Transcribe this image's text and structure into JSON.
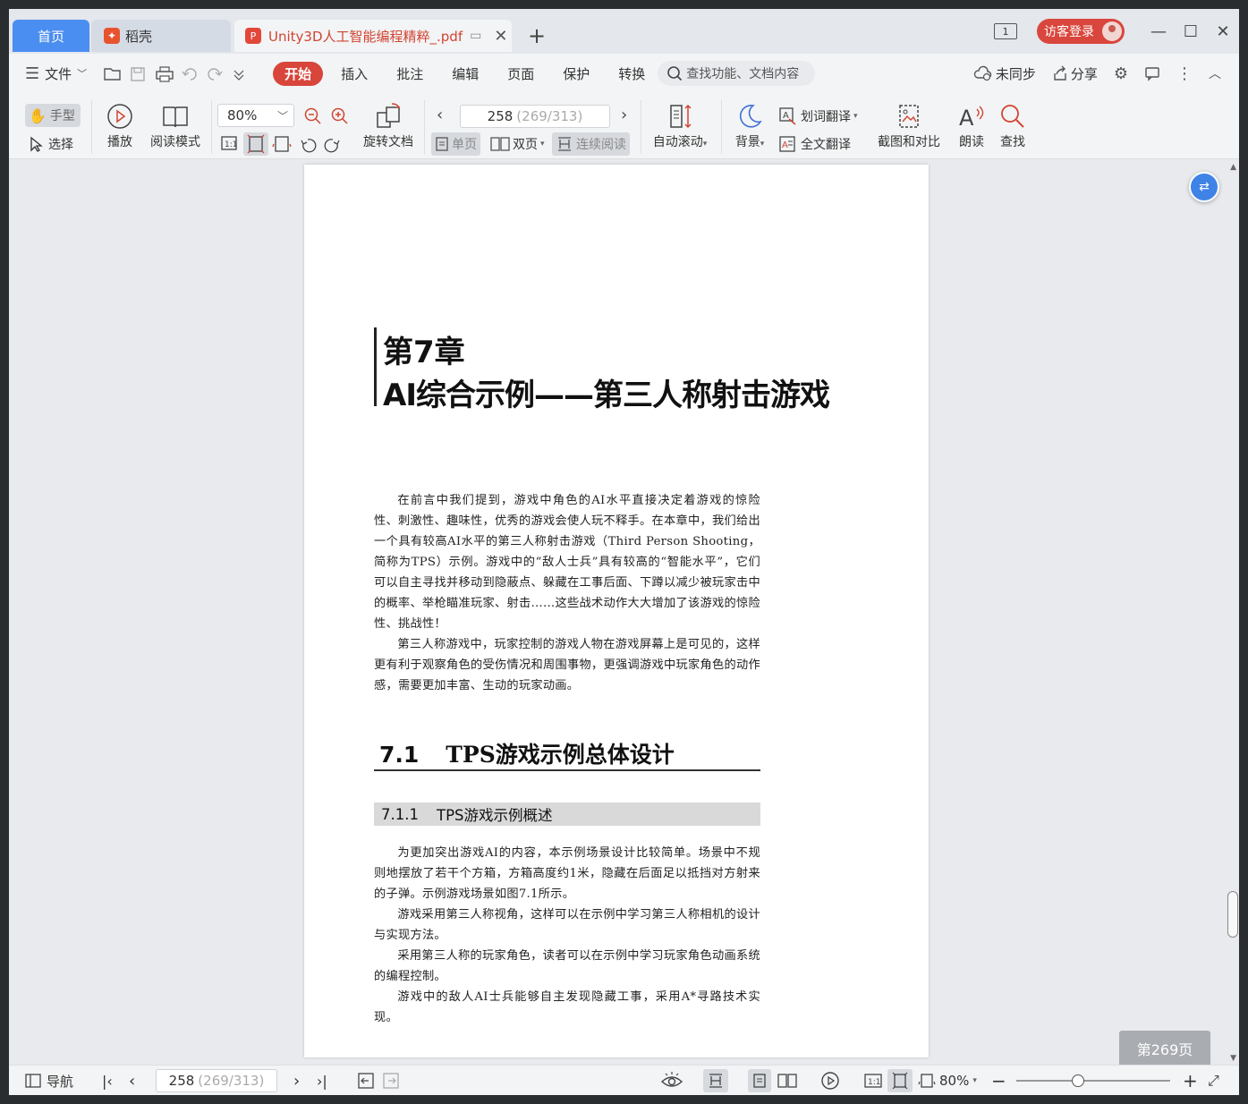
{
  "tabs": {
    "home": "首页",
    "daoke": "稻壳",
    "doc": "Unity3D人工智能编程精粹_.pdf"
  },
  "window": {
    "count": "1",
    "login": "访客登录"
  },
  "menu": {
    "file": "文件",
    "items": [
      "开始",
      "插入",
      "批注",
      "编辑",
      "页面",
      "保护",
      "转换"
    ],
    "search": "查找功能、文档内容",
    "sync": "未同步",
    "share": "分享"
  },
  "toolbar": {
    "hand": "手型",
    "select": "选择",
    "play": "播放",
    "read_mode": "阅读模式",
    "zoom": "80%",
    "rotate": "旋转文档",
    "page_current": "258",
    "page_sub": "(269/313)",
    "single": "单页",
    "double": "双页",
    "continuous": "连续阅读",
    "auto_scroll": "自动滚动",
    "background": "背景",
    "word_translate": "划词翻译",
    "full_translate": "全文翻译",
    "screenshot": "截图和对比",
    "read_aloud": "朗读",
    "find": "查找"
  },
  "document": {
    "chapter_num": "第7章",
    "chapter_title": "AI综合示例——第三人称射击游戏",
    "intro_p1": "在前言中我们提到，游戏中角色的AI水平直接决定着游戏的惊险性、刺激性、趣味性，优秀的游戏会使人玩不释手。在本章中，我们给出一个具有较高AI水平的第三人称射击游戏（Third Person Shooting，简称为TPS）示例。游戏中的“敌人士兵”具有较高的“智能水平”，它们可以自主寻找并移动到隐蔽点、躲藏在工事后面、下蹲以减少被玩家击中的概率、举枪瞄准玩家、射击……这些战术动作大大增加了该游戏的惊险性、挑战性！",
    "intro_p2": "第三人称游戏中，玩家控制的游戏人物在游戏屏幕上是可见的，这样更有利于观察角色的受伤情况和周围事物，更强调游戏中玩家角色的动作感，需要更加丰富、生动的玩家动画。",
    "section_num": "7.1",
    "section_title": "TPS游戏示例总体设计",
    "subsection_num": "7.1.1",
    "subsection_title": "TPS游戏示例概述",
    "body_p1": "为更加突出游戏AI的内容，本示例场景设计比较简单。场景中不规则地摆放了若干个方箱，方箱高度约1米，隐藏在后面足以抵挡对方射来的子弹。示例游戏场景如图7.1所示。",
    "body_p2": "游戏采用第三人称视角，这样可以在示例中学习第三人称相机的设计与实现方法。",
    "body_p3": "采用第三人称的玩家角色，读者可以在示例中学习玩家角色动画系统的编程控制。",
    "body_p4": "游戏中的敌人AI士兵能够自主发现隐藏工事，采用A*寻路技术实现。"
  },
  "page_badge": "第269页",
  "status": {
    "nav": "导航",
    "page_current": "258",
    "page_sub": "(269/313)",
    "zoom": "80%"
  }
}
